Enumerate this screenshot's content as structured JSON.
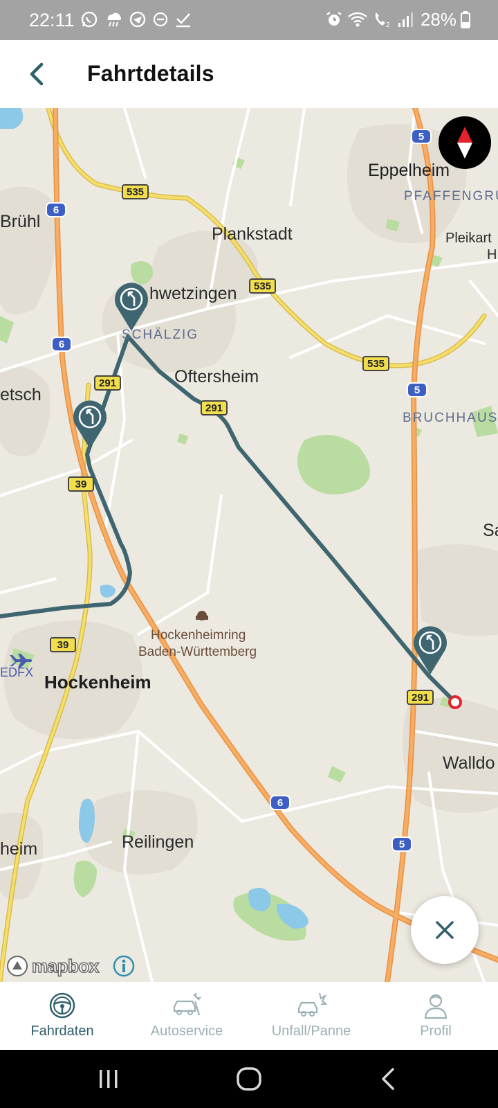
{
  "status_bar": {
    "time": "22:11",
    "battery": "28%"
  },
  "header": {
    "title": "Fahrtdetails"
  },
  "map": {
    "places": {
      "eppelheim": "Eppelheim",
      "pfaffengrund": "PFAFFENGRU",
      "pleikart": "Pleikart",
      "pleikart2": "H",
      "bruehl": "Brühl",
      "plankstadt": "Plankstadt",
      "schwetzingen": "hwetzingen",
      "schaelzig": "SCHÄLZIG",
      "oftersheim": "Oftersheim",
      "bruchhausen": "BRUCHHAUS",
      "ketsch": "etsch",
      "sa": "Sa",
      "hockenheimring1": "Hockenheimring",
      "hockenheimring2": "Baden-Württemberg",
      "edfx": "EDFX",
      "hockenheim": "Hockenheim",
      "walldorf": "Walldo",
      "reilingen": "Reilingen",
      "heim": "heim"
    },
    "shields": {
      "s535a": "535",
      "s535b": "535",
      "s535c": "535",
      "s291a": "291",
      "s291b": "291",
      "s291c": "291",
      "s39a": "39",
      "s39b": "39",
      "a6a": "6",
      "a6b": "6",
      "a6c": "6",
      "a5a": "5",
      "a5b": "5",
      "a5c": "5"
    },
    "attribution": "mapbox"
  },
  "bottom_nav": {
    "items": [
      {
        "label": "Fahrdaten",
        "icon": "steering-wheel-icon",
        "active": true
      },
      {
        "label": "Autoservice",
        "icon": "car-service-icon",
        "active": false
      },
      {
        "label": "Unfall/Panne",
        "icon": "car-crash-icon",
        "active": false
      },
      {
        "label": "Profil",
        "icon": "profile-icon",
        "active": false
      }
    ]
  },
  "colors": {
    "route": "#3f6670",
    "motorway": "#f0a050",
    "primary_road": "#f0d060",
    "accent": "#2f5f6b",
    "inactive": "#9cb0b5",
    "end_marker": "#e2232d"
  }
}
